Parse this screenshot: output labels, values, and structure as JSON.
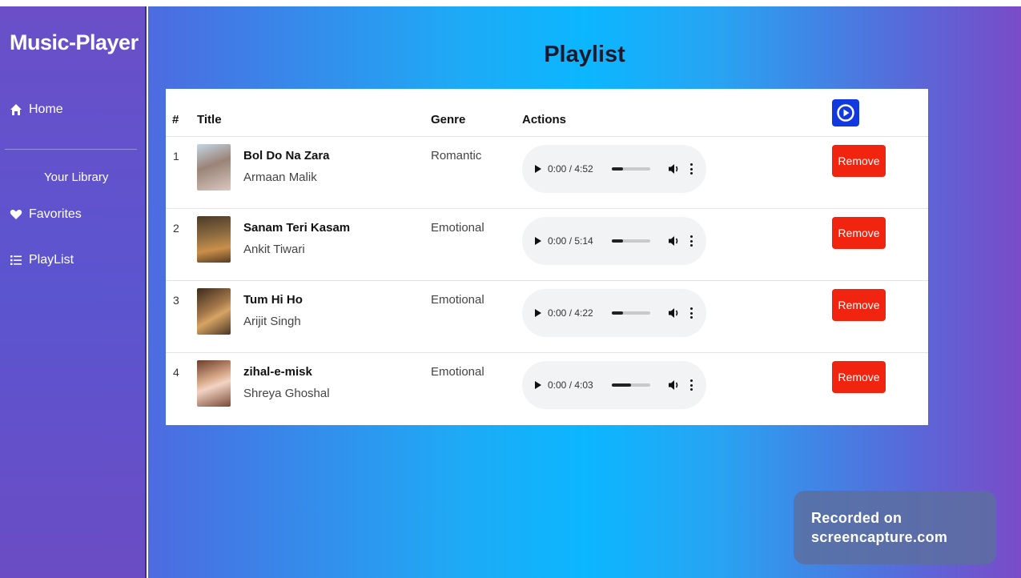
{
  "app": {
    "brand": "Music-Player"
  },
  "sidebar": {
    "home_label": "Home",
    "library_label": "Your Library",
    "favorites_label": "Favorites",
    "playlist_label": "PlayList"
  },
  "main": {
    "title": "Playlist",
    "headers": {
      "num": "#",
      "title": "Title",
      "genre": "Genre",
      "actions": "Actions"
    }
  },
  "songs": [
    {
      "num": "1",
      "title": "Bol Do Na Zara",
      "artist": "Armaan Malik",
      "genre": "Romantic",
      "time": "0:00 / 4:52",
      "remove_label": "Remove",
      "volume_level": 0.3
    },
    {
      "num": "2",
      "title": "Sanam Teri Kasam",
      "artist": "Ankit Tiwari",
      "genre": "Emotional",
      "time": "0:00 / 5:14",
      "remove_label": "Remove",
      "volume_level": 0.3
    },
    {
      "num": "3",
      "title": "Tum Hi Ho",
      "artist": "Arijit Singh",
      "genre": "Emotional",
      "time": "0:00 / 4:22",
      "remove_label": "Remove",
      "volume_level": 0.3
    },
    {
      "num": "4",
      "title": "zihal-e-misk",
      "artist": "Shreya Ghoshal",
      "genre": "Emotional",
      "time": "0:00 / 4:03",
      "remove_label": "Remove",
      "volume_level": 0.5
    }
  ],
  "watermark": {
    "line1": "Recorded on",
    "line2": "screencapture.com"
  },
  "colors": {
    "accent_blue": "#1238e0",
    "remove_red": "#f0240f",
    "sidebar_purple": "#6a4fc8",
    "main_cyan": "#0bb7ff"
  },
  "icons": {
    "home": "home-icon",
    "favorites": "heart-icon",
    "playlist": "list-icon",
    "play_all": "play-circle-icon"
  }
}
